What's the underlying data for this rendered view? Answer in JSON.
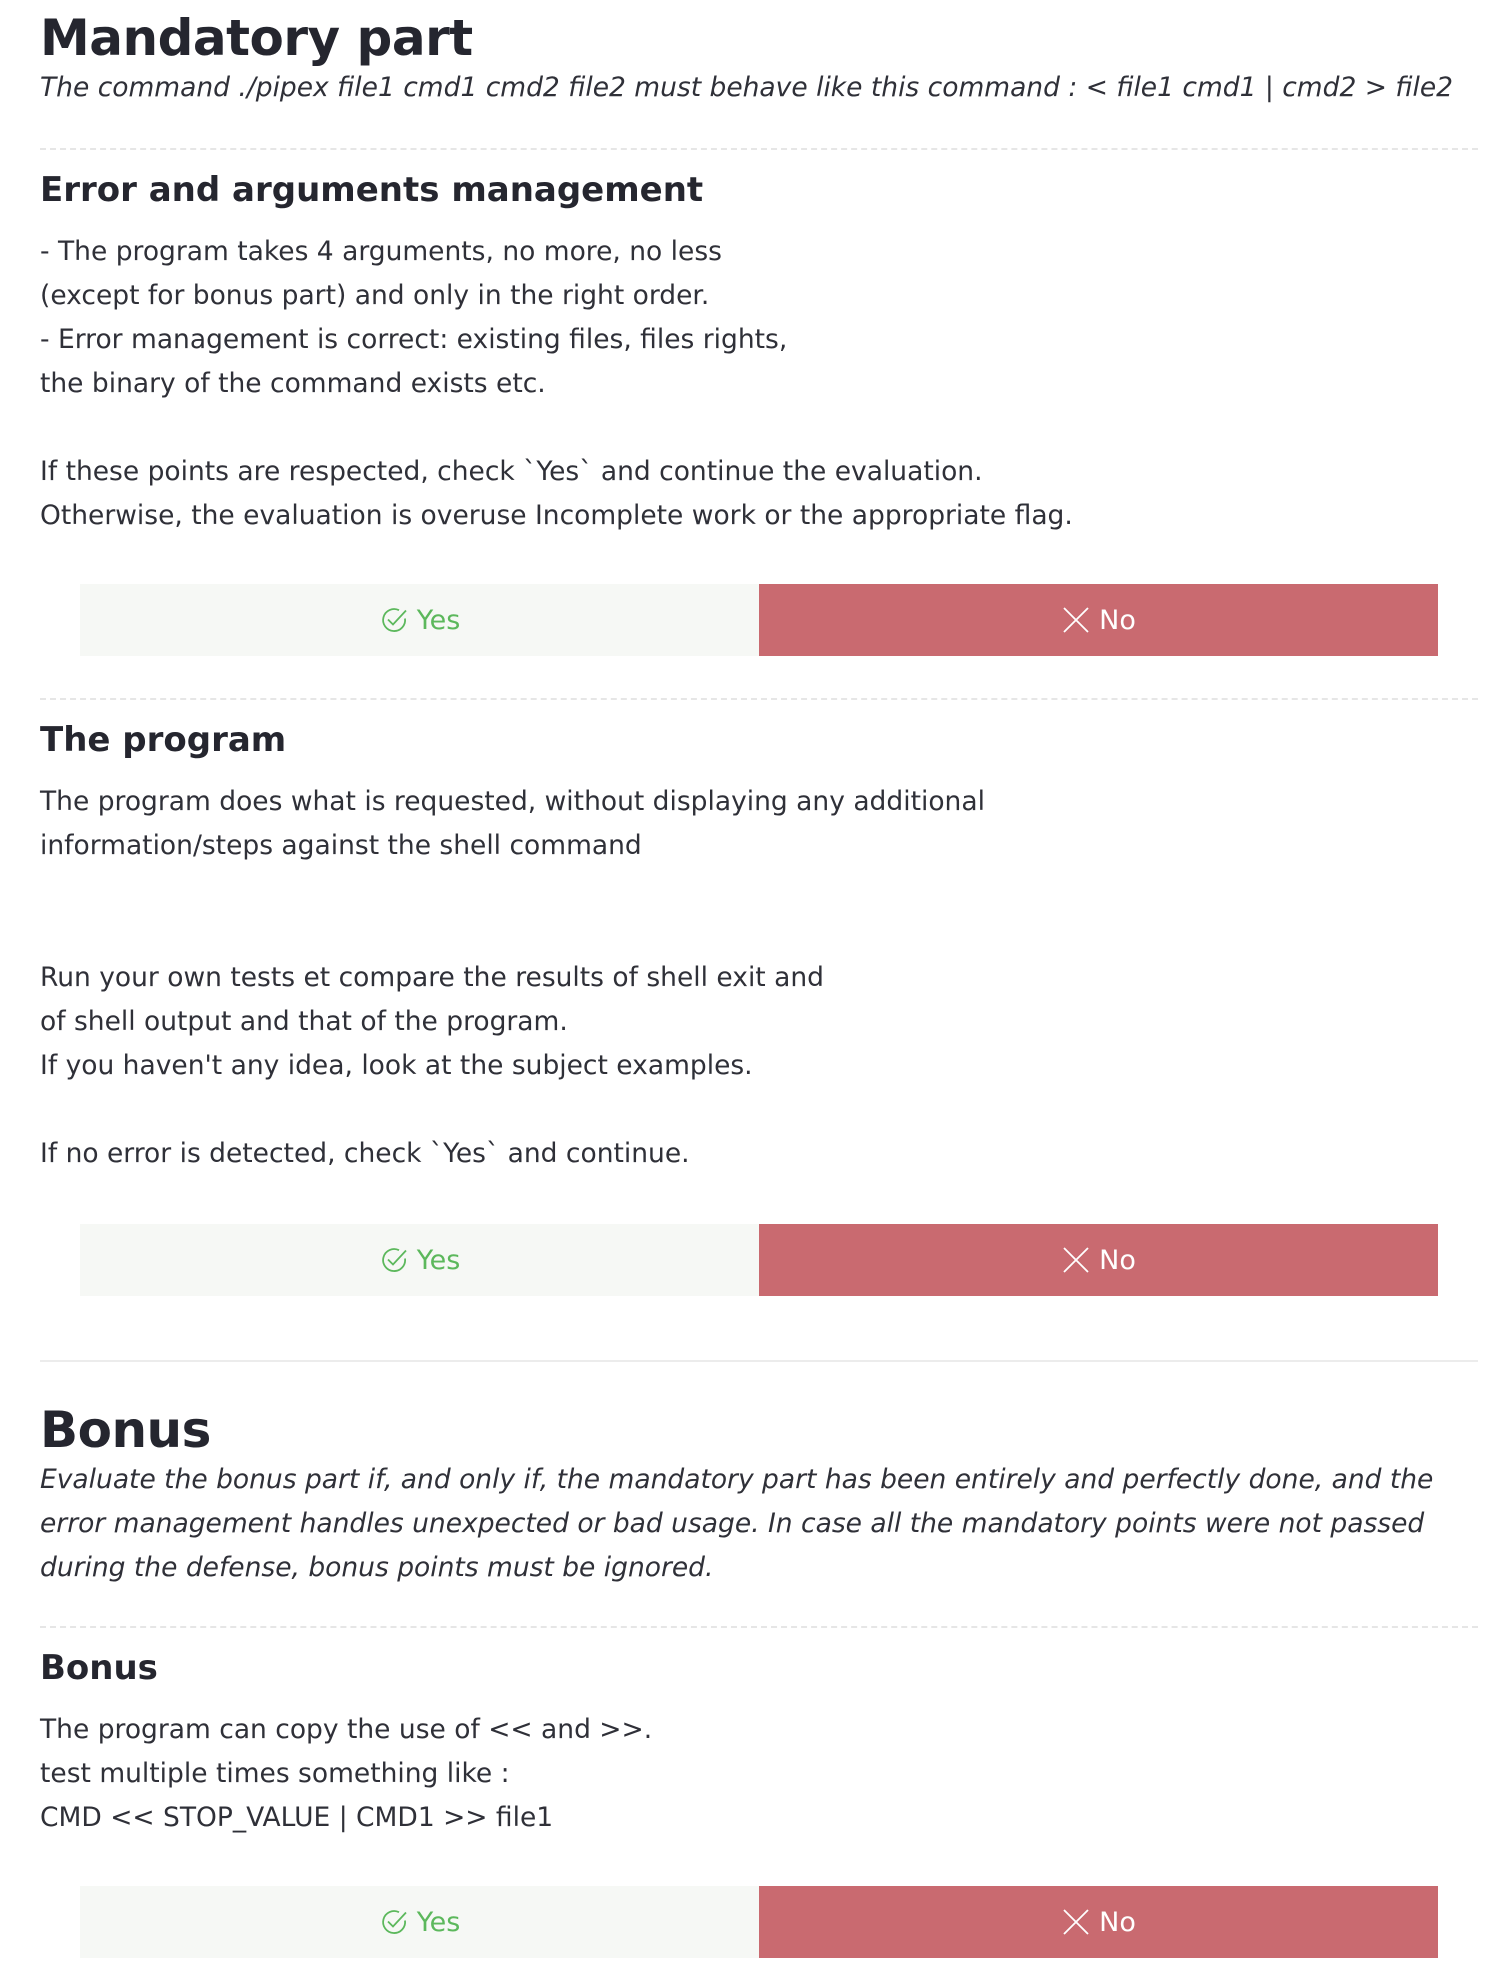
{
  "mandatory": {
    "title": "Mandatory part",
    "description": "The command ./pipex file1 cmd1 cmd2 file2 must behave like this command : < file1 cmd1 | cmd2 > file2"
  },
  "questions": [
    {
      "title": "Error and arguments management",
      "body": "- The program takes 4 arguments, no more, no less\n(except for bonus part) and only in the right order.\n- Error management is correct: existing files, files rights,\nthe binary of the command exists etc.\n\nIf these points are respected, check `Yes` and continue the evaluation.\nOtherwise, the evaluation is overuse Incomplete work or the appropriate flag."
    },
    {
      "title": "The program",
      "body": "The program does what is requested, without displaying any additional\ninformation/steps against the shell command\n\n\nRun your own tests et compare the results of shell exit and\nof shell output and that of the program.\nIf you haven't any idea, look at the subject examples.\n\nIf no error is detected, check `Yes` and continue."
    },
    {
      "title": "Bonus",
      "body": "The program can copy the use of << and >>.\ntest multiple times something like :\nCMD << STOP_VALUE | CMD1 >> file1"
    }
  ],
  "bonus": {
    "title": "Bonus",
    "description": "Evaluate the bonus part if, and only if, the mandatory part has been entirely and perfectly done, and the error management handles unexpected or bad usage. In case all the mandatory points were not passed during the defense, bonus points must be ignored."
  },
  "buttons": {
    "yes_label": "Yes",
    "no_label": "No"
  },
  "colors": {
    "yes_text": "#5cb85c",
    "yes_bg": "#f6f8f5",
    "no_bg": "#c96a70"
  }
}
